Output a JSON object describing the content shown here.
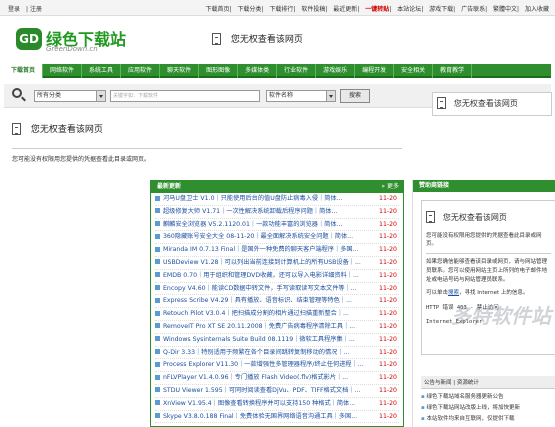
{
  "topbar": {
    "user_links": [
      "登录",
      "注册"
    ],
    "links": [
      {
        "label": "下载首页",
        "hot": false
      },
      {
        "label": "下载分类",
        "hot": false
      },
      {
        "label": "下载排行",
        "hot": false
      },
      {
        "label": "软件投稿",
        "hot": false
      },
      {
        "label": "最近更新",
        "hot": false
      },
      {
        "label": "一键转贴",
        "hot": true
      },
      {
        "label": "本站论坛",
        "hot": false
      },
      {
        "label": "游戏下载",
        "hot": false
      },
      {
        "label": "广告联系",
        "hot": false
      },
      {
        "label": "繁體中文",
        "hot": false
      },
      {
        "label": "加入收藏",
        "hot": false
      }
    ]
  },
  "logo": {
    "mark": "GD",
    "name": "绿色下载站",
    "sub": "GreenDown.cn"
  },
  "error_title": "您无权查看该网页",
  "nav": {
    "items": [
      "下载首页",
      "网络软件",
      "系统工具",
      "应用软件",
      "聊天软件",
      "图形图像",
      "多媒体类",
      "行业软件",
      "游戏娱乐",
      "编程开发",
      "安全相关",
      "教育教学"
    ],
    "active_index": 0
  },
  "search": {
    "category_value": "所有分类",
    "input_placeholder": "关键字如：下载软件",
    "field_value": "软件名称",
    "button_label": "搜索"
  },
  "main_error": {
    "title": "您无权查看该网页",
    "sub": "您可能没有权限用您提供的凭据查看此目录或网页。"
  },
  "updates": {
    "title": "最新更新",
    "more": "更多",
    "items": [
      {
        "t": "河马U盘卫士 V1.0｜只能使用后台的值U盘防止病毒入侵｜简体...",
        "d": "11-20"
      },
      {
        "t": "超级修复大师 V1.71｜一次性解决系统卸载后程序问题｜简体...",
        "d": "11-20"
      },
      {
        "t": "麒麟安全浏览器 V5.2.1120.01｜一款功能丰富的浏览器｜简体...",
        "d": "11-20"
      },
      {
        "t": "360隐藏账号安全大全 08-11-20｜最全面解决系统安全问题｜简体...",
        "d": "11-20"
      },
      {
        "t": "Miranda IM 0.7.13 Final｜是国外一种免费的聊天客户端程序｜多国...",
        "d": "11-20"
      },
      {
        "t": "USBDeview V1.28｜可以列出当前连接到计算机上的所有USB设备｜...",
        "d": "11-20"
      },
      {
        "t": "EMDB 0.70｜用于组织和管理DVD收藏，还可以导入电影详细资料｜...",
        "d": "11-20"
      },
      {
        "t": "Encopy V4.60｜能读CD数据中转文件，手写读取读写文本文件等｜...",
        "d": "11-20"
      },
      {
        "t": "Express Scribe V4.29｜具有播放、语音标识、结束管理等特色｜...",
        "d": "11-20"
      },
      {
        "t": "Retouch Pilot V3.0.4｜把扫描成分割的相片通过扫描重新整合｜...",
        "d": "11-20"
      },
      {
        "t": "RemoveIT Pro XT SE 20.11.2008｜免费广告病毒程序清除工具｜...",
        "d": "11-20"
      },
      {
        "t": "Windows Sysinternals Suite Build 08.1119｜微软工具程序集｜...",
        "d": "11-20"
      },
      {
        "t": "Q-Dir 3.33｜特别适用于频繁在各个目录间跳转复制移动的情况｜...",
        "d": "11-20"
      },
      {
        "t": "Process Explorer V11.30｜一款增强性多管理器程序/终止任何进程｜...",
        "d": "11-20"
      },
      {
        "t": "nFLVPlayer V1.4.0.96｜专门播放 Flash Video(.flv)格式影片｜...",
        "d": "11-20"
      },
      {
        "t": "STDU Viewer 1.595｜可同时阅读查看DjVu、PDF、TIFF格式文档｜...",
        "d": "11-20"
      },
      {
        "t": "XnView V1.95.4｜图像查看转换程序并可以支持150 种格式｜简体...",
        "d": "11-20"
      },
      {
        "t": "Skype V3.8.0.188 Final｜免费体验无国界网络语音沟通工具｜多国...",
        "d": "11-20"
      }
    ]
  },
  "sponsor": {
    "title": "赞助商链接",
    "inner_title": "您无权查看该网页",
    "inner_sub": "您可能没有权限用您提供的凭据查看此目录或网页。",
    "p1": "如果您确信能够查看该目录或网页，请与网站管理员联系。您可以使用网站主页上所列的电子邮件地址或电话号码与网站管理员联系。",
    "p2_prefix": "可以单击",
    "p2_link": "搜索",
    "p2_suffix": "，寻找 Internet 上的信息。",
    "mono1": "HTTP 错误 403 - 禁止访问",
    "mono2": "Internet Explorer",
    "lower_tabs": "公告与新闻 | 资源统计",
    "lower_items": [
      "绿色下载站域名服务器更新公告",
      "绿色下载站网站改版上线，将加快更新",
      "本站软件均来自互联网，仅提供下载"
    ]
  },
  "watermark": "多特软件站"
}
